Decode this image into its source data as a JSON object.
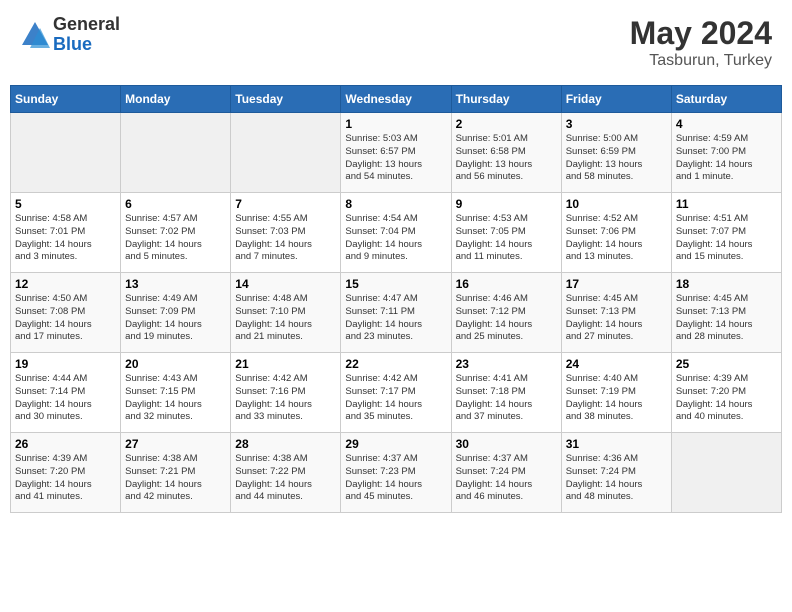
{
  "header": {
    "logo_general": "General",
    "logo_blue": "Blue",
    "month": "May 2024",
    "location": "Tasburun, Turkey"
  },
  "days_of_week": [
    "Sunday",
    "Monday",
    "Tuesday",
    "Wednesday",
    "Thursday",
    "Friday",
    "Saturday"
  ],
  "weeks": [
    [
      {
        "day": "",
        "info": ""
      },
      {
        "day": "",
        "info": ""
      },
      {
        "day": "",
        "info": ""
      },
      {
        "day": "1",
        "info": "Sunrise: 5:03 AM\nSunset: 6:57 PM\nDaylight: 13 hours\nand 54 minutes."
      },
      {
        "day": "2",
        "info": "Sunrise: 5:01 AM\nSunset: 6:58 PM\nDaylight: 13 hours\nand 56 minutes."
      },
      {
        "day": "3",
        "info": "Sunrise: 5:00 AM\nSunset: 6:59 PM\nDaylight: 13 hours\nand 58 minutes."
      },
      {
        "day": "4",
        "info": "Sunrise: 4:59 AM\nSunset: 7:00 PM\nDaylight: 14 hours\nand 1 minute."
      }
    ],
    [
      {
        "day": "5",
        "info": "Sunrise: 4:58 AM\nSunset: 7:01 PM\nDaylight: 14 hours\nand 3 minutes."
      },
      {
        "day": "6",
        "info": "Sunrise: 4:57 AM\nSunset: 7:02 PM\nDaylight: 14 hours\nand 5 minutes."
      },
      {
        "day": "7",
        "info": "Sunrise: 4:55 AM\nSunset: 7:03 PM\nDaylight: 14 hours\nand 7 minutes."
      },
      {
        "day": "8",
        "info": "Sunrise: 4:54 AM\nSunset: 7:04 PM\nDaylight: 14 hours\nand 9 minutes."
      },
      {
        "day": "9",
        "info": "Sunrise: 4:53 AM\nSunset: 7:05 PM\nDaylight: 14 hours\nand 11 minutes."
      },
      {
        "day": "10",
        "info": "Sunrise: 4:52 AM\nSunset: 7:06 PM\nDaylight: 14 hours\nand 13 minutes."
      },
      {
        "day": "11",
        "info": "Sunrise: 4:51 AM\nSunset: 7:07 PM\nDaylight: 14 hours\nand 15 minutes."
      }
    ],
    [
      {
        "day": "12",
        "info": "Sunrise: 4:50 AM\nSunset: 7:08 PM\nDaylight: 14 hours\nand 17 minutes."
      },
      {
        "day": "13",
        "info": "Sunrise: 4:49 AM\nSunset: 7:09 PM\nDaylight: 14 hours\nand 19 minutes."
      },
      {
        "day": "14",
        "info": "Sunrise: 4:48 AM\nSunset: 7:10 PM\nDaylight: 14 hours\nand 21 minutes."
      },
      {
        "day": "15",
        "info": "Sunrise: 4:47 AM\nSunset: 7:11 PM\nDaylight: 14 hours\nand 23 minutes."
      },
      {
        "day": "16",
        "info": "Sunrise: 4:46 AM\nSunset: 7:12 PM\nDaylight: 14 hours\nand 25 minutes."
      },
      {
        "day": "17",
        "info": "Sunrise: 4:45 AM\nSunset: 7:13 PM\nDaylight: 14 hours\nand 27 minutes."
      },
      {
        "day": "18",
        "info": "Sunrise: 4:45 AM\nSunset: 7:13 PM\nDaylight: 14 hours\nand 28 minutes."
      }
    ],
    [
      {
        "day": "19",
        "info": "Sunrise: 4:44 AM\nSunset: 7:14 PM\nDaylight: 14 hours\nand 30 minutes."
      },
      {
        "day": "20",
        "info": "Sunrise: 4:43 AM\nSunset: 7:15 PM\nDaylight: 14 hours\nand 32 minutes."
      },
      {
        "day": "21",
        "info": "Sunrise: 4:42 AM\nSunset: 7:16 PM\nDaylight: 14 hours\nand 33 minutes."
      },
      {
        "day": "22",
        "info": "Sunrise: 4:42 AM\nSunset: 7:17 PM\nDaylight: 14 hours\nand 35 minutes."
      },
      {
        "day": "23",
        "info": "Sunrise: 4:41 AM\nSunset: 7:18 PM\nDaylight: 14 hours\nand 37 minutes."
      },
      {
        "day": "24",
        "info": "Sunrise: 4:40 AM\nSunset: 7:19 PM\nDaylight: 14 hours\nand 38 minutes."
      },
      {
        "day": "25",
        "info": "Sunrise: 4:39 AM\nSunset: 7:20 PM\nDaylight: 14 hours\nand 40 minutes."
      }
    ],
    [
      {
        "day": "26",
        "info": "Sunrise: 4:39 AM\nSunset: 7:20 PM\nDaylight: 14 hours\nand 41 minutes."
      },
      {
        "day": "27",
        "info": "Sunrise: 4:38 AM\nSunset: 7:21 PM\nDaylight: 14 hours\nand 42 minutes."
      },
      {
        "day": "28",
        "info": "Sunrise: 4:38 AM\nSunset: 7:22 PM\nDaylight: 14 hours\nand 44 minutes."
      },
      {
        "day": "29",
        "info": "Sunrise: 4:37 AM\nSunset: 7:23 PM\nDaylight: 14 hours\nand 45 minutes."
      },
      {
        "day": "30",
        "info": "Sunrise: 4:37 AM\nSunset: 7:24 PM\nDaylight: 14 hours\nand 46 minutes."
      },
      {
        "day": "31",
        "info": "Sunrise: 4:36 AM\nSunset: 7:24 PM\nDaylight: 14 hours\nand 48 minutes."
      },
      {
        "day": "",
        "info": ""
      }
    ]
  ]
}
